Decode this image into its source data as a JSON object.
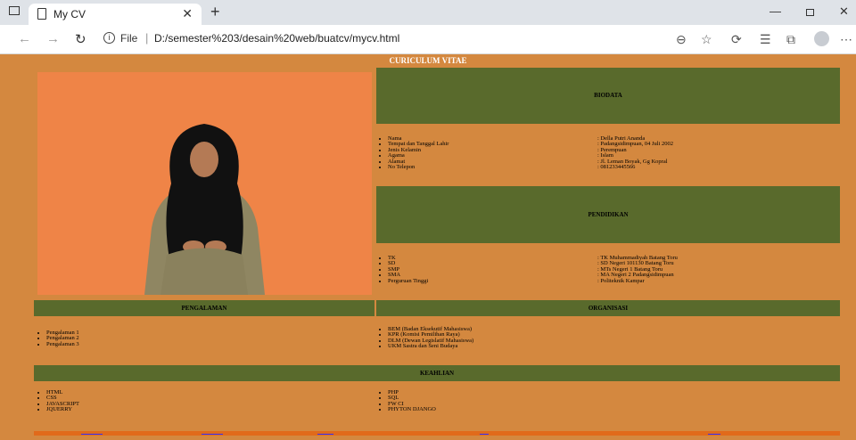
{
  "browser": {
    "tab_title": "My CV",
    "address_protocol": "File",
    "url": "D:/semester%203/desain%20web/buatcv/mycv.html"
  },
  "page": {
    "title": "CURICULUM VITAE",
    "biodata": {
      "heading": "BIODATA",
      "labels": [
        "Nama",
        "Tempat dan Tanggal Lahir",
        "Jenis Kelamin",
        "Agama",
        "Alamat",
        "No Telepon"
      ],
      "values": [
        ": Della Putri Ananda",
        ": Padangsidimpuan, 04 Juli 2002",
        ": Perempuan",
        ": Islam",
        ": Jl. Leman Boyak, Gg Kopral",
        ": 081233445566"
      ]
    },
    "pendidikan": {
      "heading": "PENDIDIKAN",
      "labels": [
        "TK",
        "SD",
        "SMP",
        "SMA",
        "Perguruan Tinggi"
      ],
      "values": [
        ": TK Muhammadiyah Batang Toru",
        ": SD Negeri 101130 Batang Toru",
        ": MTs Negeri 1 Batang Toru",
        ": MA Negeri 2 Padangsidimpuan",
        ": Politeknik Kampar"
      ]
    },
    "pengalaman": {
      "heading": "PENGALAMAN",
      "items": [
        "Pengalaman 1",
        "Pengalaman 2",
        "Pengalaman 3"
      ]
    },
    "organisasi": {
      "heading": "ORGANISASI",
      "items": [
        "BEM (Badan Eksekutif Mahasiswa)",
        "KPR (Komisi Pemilihan Raya)",
        "DLM (Dewan Legislatif Mahasiswa)",
        "UKM Sastra dan Seni Budaya"
      ]
    },
    "keahlian": {
      "heading": "KEAHLIAN",
      "left": [
        "HTML",
        "CSS",
        "JAVASCRIPT",
        "JQUERRY"
      ],
      "right": [
        "PHP",
        "SQL",
        "FW CI",
        "PHYTON DJANGO"
      ]
    }
  },
  "icons": {
    "window": "window-icon",
    "page": "page-icon",
    "close": "close-icon",
    "new_tab": "plus-icon",
    "back": "back-arrow-icon",
    "forward": "forward-arrow-icon",
    "reload": "reload-icon",
    "info": "info-icon",
    "zoom": "zoom-icon",
    "favorite_add": "star-plus-icon",
    "extensions": "extensions-icon",
    "favorites": "favorites-icon",
    "collections": "collections-icon",
    "profile": "profile-icon",
    "more": "more-icon"
  },
  "colors": {
    "page_bg": "#d4883f",
    "band": "#596a2c",
    "photo_bg": "#ef8447",
    "footer": "#e16a1a"
  }
}
